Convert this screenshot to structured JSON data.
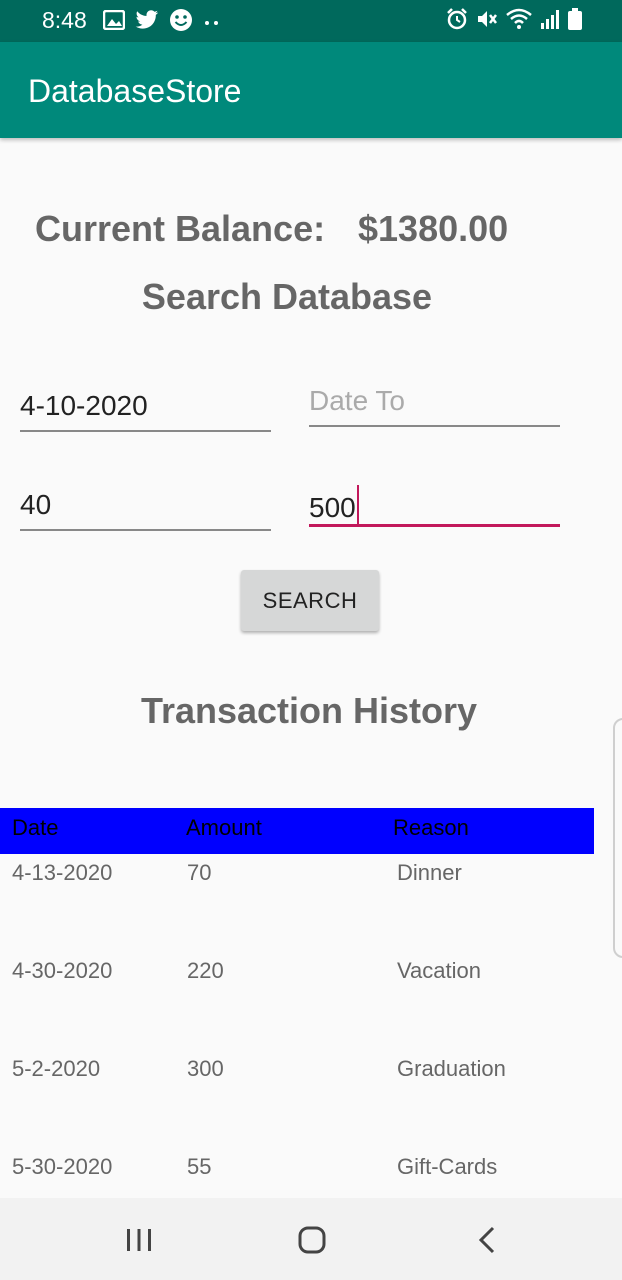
{
  "status_bar": {
    "time": "8:48",
    "left_icons": [
      "image-icon",
      "twitter-icon",
      "smiley-icon",
      "more-dots-icon"
    ],
    "right_icons": [
      "alarm-icon",
      "mute-icon",
      "wifi-icon",
      "signal-icon",
      "battery-icon"
    ]
  },
  "app_bar": {
    "title": "DatabaseStore",
    "color": "#00897b"
  },
  "balance": {
    "label": "Current Balance:",
    "value": "$1380.00"
  },
  "search": {
    "title": "Search Database",
    "date_from_value": "4-10-2020",
    "date_to_placeholder": "Date To",
    "amount_min_value": "40",
    "amount_max_value": "500",
    "button_label": "SEARCH"
  },
  "history": {
    "title": "Transaction History",
    "columns": [
      "Date",
      "Amount",
      "Reason"
    ],
    "header_color": "#0000ff",
    "rows": [
      {
        "date": "4-13-2020",
        "amount": "70",
        "reason": "Dinner"
      },
      {
        "date": "4-30-2020",
        "amount": "220",
        "reason": "Vacation"
      },
      {
        "date": "5-2-2020",
        "amount": "300",
        "reason": "Graduation"
      },
      {
        "date": "5-30-2020",
        "amount": "55",
        "reason": "Gift-Cards"
      }
    ]
  },
  "nav_bar": {
    "buttons": [
      "recent-apps-icon",
      "home-icon",
      "back-icon"
    ]
  },
  "accent_color": "#c2185b"
}
